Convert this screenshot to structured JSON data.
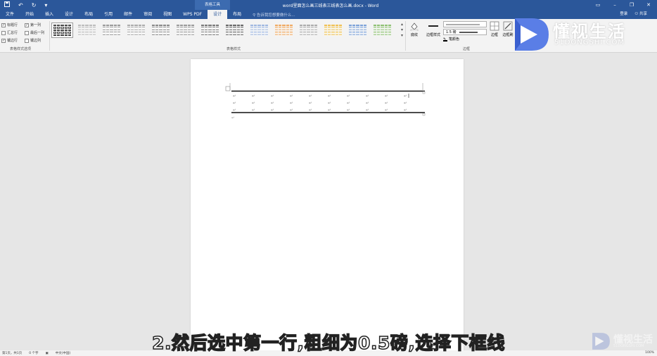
{
  "titlebar": {
    "tool_tab_header": "表格工具",
    "doc_title": "word里面怎么画三线表三线表怎么画.docx - Word",
    "qat_undo": "↶",
    "qat_redo": "↻"
  },
  "tabs": [
    {
      "label": "文件"
    },
    {
      "label": "开始"
    },
    {
      "label": "插入"
    },
    {
      "label": "设计"
    },
    {
      "label": "布局"
    },
    {
      "label": "引用"
    },
    {
      "label": "邮件"
    },
    {
      "label": "审阅"
    },
    {
      "label": "视图"
    },
    {
      "label": "WPS PDF"
    },
    {
      "label": "设计",
      "active": true
    },
    {
      "label": "布局"
    }
  ],
  "tell_me": "告诉我您想要做什么...",
  "account": {
    "login": "登录",
    "share": "共享"
  },
  "style_options": {
    "group_label": "表格样式选项",
    "items": [
      {
        "label": "标题行",
        "checked": true
      },
      {
        "label": "第一列",
        "checked": true
      },
      {
        "label": "汇总行",
        "checked": false
      },
      {
        "label": "最后一列",
        "checked": false
      },
      {
        "label": "镶边行",
        "checked": true
      },
      {
        "label": "镶边列",
        "checked": false
      }
    ]
  },
  "table_styles": {
    "group_label": "表格样式",
    "count": 14
  },
  "shading_label": "底纹",
  "borders": {
    "group_label": "边框",
    "border_styles_label": "边框样式",
    "weight": "1.5 磅",
    "pen_color": "笔颜色",
    "borders_label": "边框",
    "border_painter_label": "边框刷"
  },
  "logo": {
    "main": "懂视生活",
    "sub": "51DONGSHI.COM"
  },
  "table": {
    "rows": 3,
    "cols": 10,
    "cell_mark": "↵"
  },
  "subtitle": "2.然后选中第一行,粗细为0.5磅,选择下框线",
  "watermark": {
    "main": "懂视生活",
    "sub": "51DONGSHI.COM"
  },
  "statusbar": {
    "page": "第1页，共1页",
    "words": "0 个字",
    "lang": "中文(中国)",
    "zoom": "100%"
  }
}
